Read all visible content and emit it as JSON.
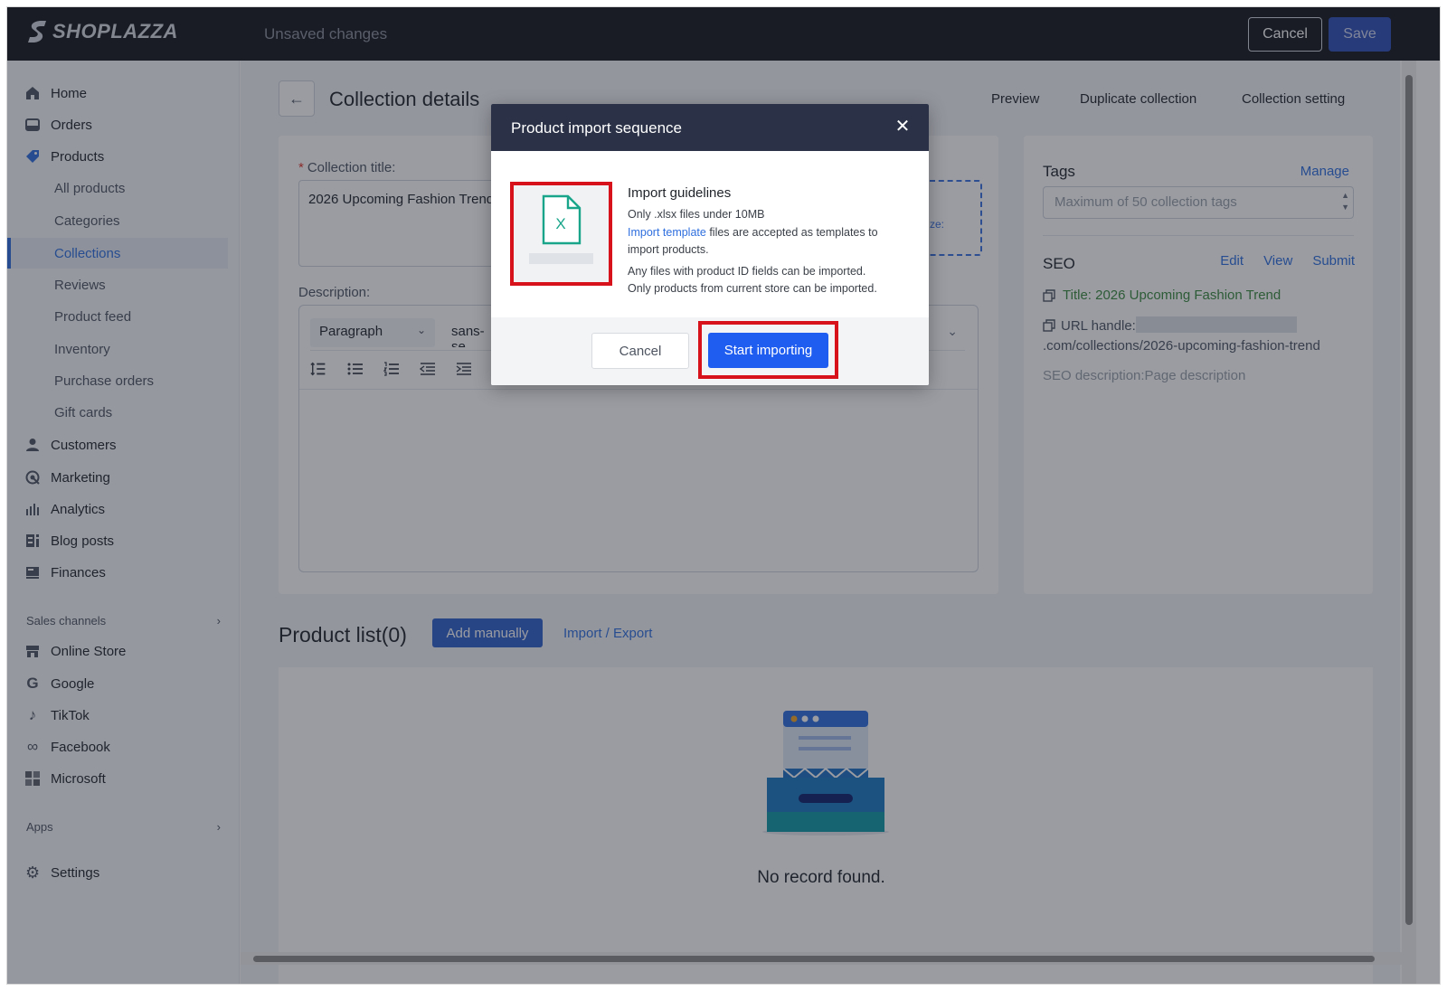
{
  "topbar": {
    "logo_text": "SHOPLAZZA",
    "status": "Unsaved changes",
    "cancel_label": "Cancel",
    "save_label": "Save"
  },
  "sidebar": {
    "home": "Home",
    "orders": "Orders",
    "products": "Products",
    "product_subitems": [
      "All products",
      "Categories",
      "Collections",
      "Reviews",
      "Product feed",
      "Inventory",
      "Purchase orders",
      "Gift cards"
    ],
    "customers": "Customers",
    "marketing": "Marketing",
    "analytics": "Analytics",
    "blog_posts": "Blog posts",
    "finances": "Finances",
    "sales_channels_label": "Sales channels",
    "channels": [
      "Online Store",
      "Google",
      "TikTok",
      "Facebook",
      "Microsoft"
    ],
    "apps_label": "Apps",
    "settings": "Settings",
    "active_item": "Collections"
  },
  "page": {
    "title": "Collection details",
    "links": [
      "Preview",
      "Duplicate collection",
      "Collection setting"
    ]
  },
  "form": {
    "collection_title_label": "Collection title",
    "required_mark": "*",
    "collection_title_value": "2026 Upcoming Fashion Trend",
    "description_label": "Description:",
    "dashed_partial_text": "ze:",
    "paragraph_select": "Paragraph",
    "font_select": "sans-se"
  },
  "right_panel": {
    "tags_label": "Tags",
    "manage_link": "Manage",
    "tags_placeholder": "Maximum of 50 collection tags",
    "seo_label": "SEO",
    "seo_links": [
      "Edit",
      "View",
      "Submit"
    ],
    "seo_title": "Title: 2026 Upcoming Fashion Trend",
    "url_prefix": "URL handle:",
    "url_suffix": ".com/collections/2026-upcoming-fashion-trend",
    "seo_description": "SEO description:Page description"
  },
  "product_list": {
    "title": "Product list(0)",
    "add_manually": "Add manually",
    "import_export": "Import / Export",
    "empty_text": "No record found."
  },
  "modal": {
    "title": "Product import sequence",
    "guide_title": "Import guidelines",
    "line1": "Only .xlsx files under 10MB",
    "template_link": "Import template",
    "line2_rest": " files are accepted as templates to import products.",
    "line3": "Any files with product ID fields can be imported.",
    "line4": "Only products from current store can be imported.",
    "file_icon_letter": "X",
    "cancel_label": "Cancel",
    "start_label": "Start importing"
  },
  "colors": {
    "highlight": "#d8121a",
    "primary": "#1f5cf0",
    "link": "#2f6fde",
    "topbar": "#15171c",
    "modal_header": "#2b3247"
  }
}
